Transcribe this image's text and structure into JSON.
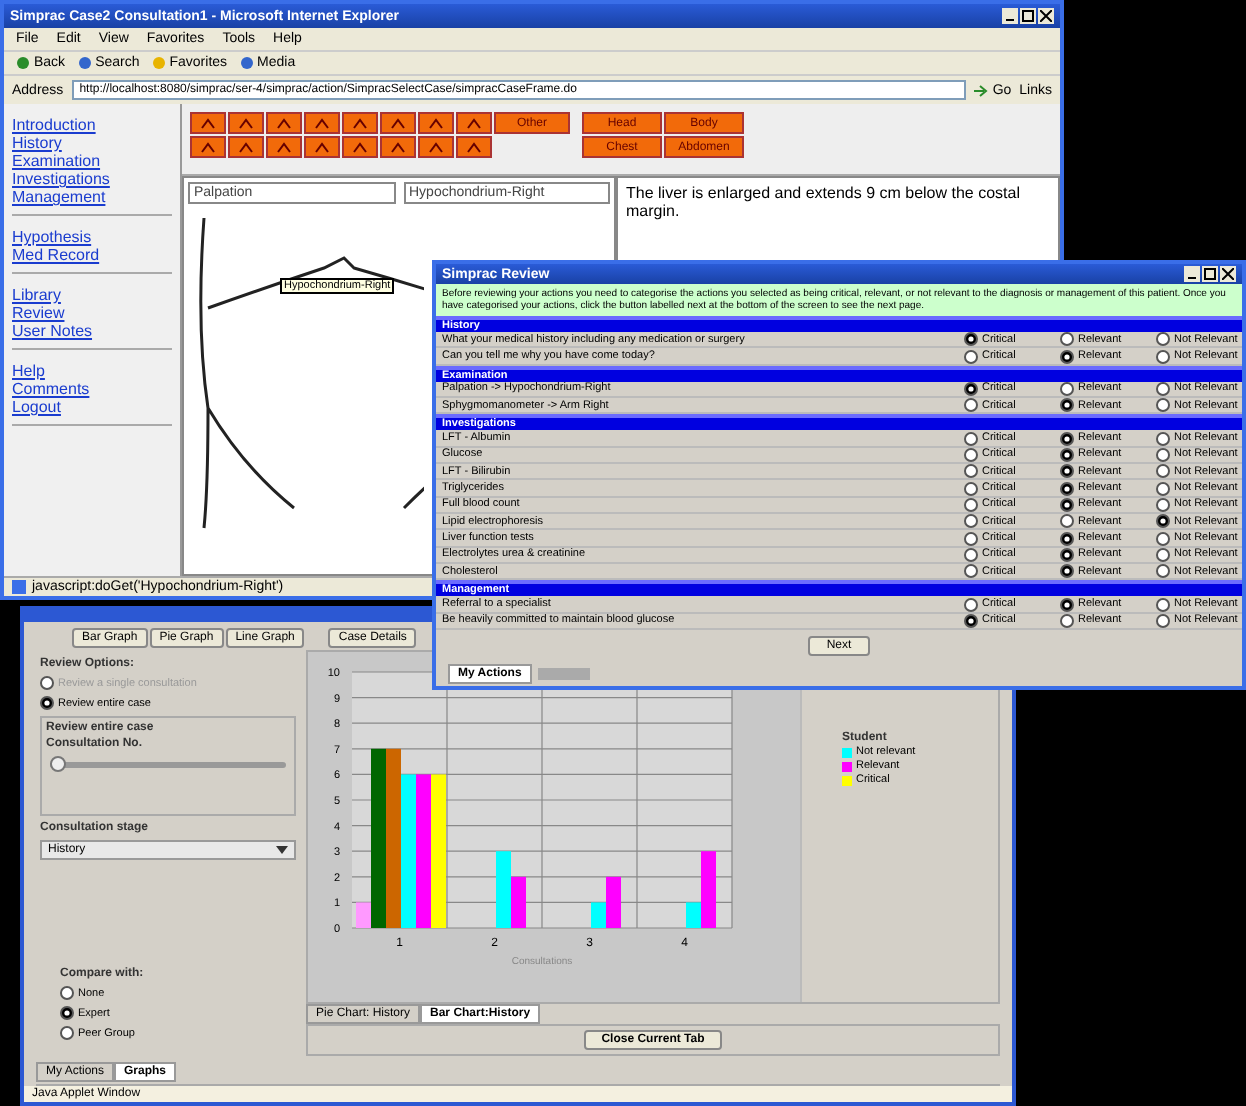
{
  "ie": {
    "title": "Simprac Case2 Consultation1 - Microsoft Internet Explorer",
    "menu": [
      "File",
      "Edit",
      "View",
      "Favorites",
      "Tools",
      "Help"
    ],
    "toolbar": [
      "Back",
      "Search",
      "Favorites",
      "Media"
    ],
    "address_label": "Address",
    "address": "http://localhost:8080/simprac/ser-4/simprac/action/SimpracSelectCase/simpracCaseFrame.do",
    "go": "Go",
    "links": "Links",
    "nav_groups": [
      [
        "Introduction",
        "History",
        "Examination",
        "Investigations",
        "Management"
      ],
      [
        "Hypothesis",
        "Med Record"
      ],
      [
        "Library",
        "Review",
        "User Notes"
      ],
      [
        "Help",
        "Comments",
        "Logout"
      ]
    ],
    "region_buttons": [
      [
        "Other"
      ],
      [
        "Head",
        "Body"
      ],
      [
        "Chest",
        "Abdomen"
      ]
    ],
    "exam_method": "Palpation",
    "exam_site": "Hypochondrium-Right",
    "tooltip": "Hypochondrium-Right",
    "finding": "The liver is enlarged and extends 9 cm below the costal margin.",
    "status": "javascript:doGet('Hypochondrium-Right')"
  },
  "review": {
    "title": "Simprac Review",
    "instructions": "Before reviewing your actions you need to categorise the actions you selected as being critical, relevant, or not relevant to the diagnosis or management of this patient. Once you have categorised your actions, click the button labelled next at the bottom of the screen to see the next page.",
    "sections": [
      {
        "heading": "History",
        "rows": [
          {
            "question": "What your medical history including any medication or surgery",
            "options": [
              {
                "label": "Critical",
                "selected": true
              },
              {
                "label": "Relevant",
                "selected": false
              },
              {
                "label": "Not Relevant",
                "selected": false
              }
            ]
          },
          {
            "question": "Can you tell me why you have come today?",
            "options": [
              {
                "label": "Critical",
                "selected": false
              },
              {
                "label": "Relevant",
                "selected": true
              },
              {
                "label": "Not Relevant",
                "selected": false
              }
            ]
          }
        ]
      },
      {
        "heading": "Examination",
        "rows": [
          {
            "question": "Palpation -> Hypochondrium-Right",
            "options": [
              {
                "label": "Critical",
                "selected": true
              },
              {
                "label": "Relevant",
                "selected": false
              },
              {
                "label": "Not Relevant",
                "selected": false
              }
            ]
          },
          {
            "question": "Sphygmomanometer -> Arm Right",
            "options": [
              {
                "label": "Critical",
                "selected": false
              },
              {
                "label": "Relevant",
                "selected": true
              },
              {
                "label": "Not Relevant",
                "selected": false
              }
            ]
          }
        ]
      },
      {
        "heading": "Investigations",
        "rows": [
          {
            "question": "LFT - Albumin",
            "options": [
              {
                "label": "Critical",
                "selected": false
              },
              {
                "label": "Relevant",
                "selected": true
              },
              {
                "label": "Not Relevant",
                "selected": false
              }
            ]
          },
          {
            "question": "Glucose",
            "options": [
              {
                "label": "Critical",
                "selected": false
              },
              {
                "label": "Relevant",
                "selected": true
              },
              {
                "label": "Not Relevant",
                "selected": false
              }
            ]
          },
          {
            "question": "LFT - Bilirubin",
            "options": [
              {
                "label": "Critical",
                "selected": false
              },
              {
                "label": "Relevant",
                "selected": true
              },
              {
                "label": "Not Relevant",
                "selected": false
              }
            ]
          },
          {
            "question": "Triglycerides",
            "options": [
              {
                "label": "Critical",
                "selected": false
              },
              {
                "label": "Relevant",
                "selected": true
              },
              {
                "label": "Not Relevant",
                "selected": false
              }
            ]
          },
          {
            "question": "Full blood count",
            "options": [
              {
                "label": "Critical",
                "selected": false
              },
              {
                "label": "Relevant",
                "selected": true
              },
              {
                "label": "Not Relevant",
                "selected": false
              }
            ]
          },
          {
            "question": "Lipid electrophoresis",
            "options": [
              {
                "label": "Critical",
                "selected": false
              },
              {
                "label": "Relevant",
                "selected": false
              },
              {
                "label": "Not Relevant",
                "selected": true
              }
            ]
          },
          {
            "question": "Liver function tests",
            "options": [
              {
                "label": "Critical",
                "selected": false
              },
              {
                "label": "Relevant",
                "selected": true
              },
              {
                "label": "Not Relevant",
                "selected": false
              }
            ]
          },
          {
            "question": "Electrolytes urea & creatinine",
            "options": [
              {
                "label": "Critical",
                "selected": false
              },
              {
                "label": "Relevant",
                "selected": true
              },
              {
                "label": "Not Relevant",
                "selected": false
              }
            ]
          },
          {
            "question": "Cholesterol",
            "options": [
              {
                "label": "Critical",
                "selected": false
              },
              {
                "label": "Relevant",
                "selected": true
              },
              {
                "label": "Not Relevant",
                "selected": false
              }
            ]
          }
        ]
      },
      {
        "heading": "Management",
        "rows": [
          {
            "question": "Referral to a specialist",
            "options": [
              {
                "label": "Critical",
                "selected": false
              },
              {
                "label": "Relevant",
                "selected": true
              },
              {
                "label": "Not Relevant",
                "selected": false
              }
            ]
          },
          {
            "question": "Be heavily committed to maintain blood glucose",
            "options": [
              {
                "label": "Critical",
                "selected": true
              },
              {
                "label": "Relevant",
                "selected": false
              },
              {
                "label": "Not Relevant",
                "selected": false
              }
            ]
          }
        ]
      }
    ],
    "next": "Next",
    "tab": "My Actions"
  },
  "applet": {
    "graph_buttons": [
      "Bar Graph",
      "Pie Graph",
      "Line Graph"
    ],
    "details_button": "Case Details",
    "review_label": "Review Options:",
    "review_options": [
      {
        "label": "Review a single consultation",
        "selected": false,
        "disabled": true
      },
      {
        "label": "Review entire case",
        "selected": true,
        "disabled": false
      }
    ],
    "group_label": "Review entire case",
    "slider_label": "Consultation No.",
    "slider": {
      "level": 0
    },
    "stage_label": "Consultation stage",
    "stage_value": "History",
    "compare_label": "Compare with:",
    "compare_options": [
      {
        "label": "None",
        "selected": false
      },
      {
        "label": "Expert",
        "selected": true
      },
      {
        "label": "Peer Group",
        "selected": false
      }
    ],
    "chart_data": {
      "type": "bar",
      "grid": true,
      "xlabel": "Consultations",
      "categories": [
        "1",
        "2",
        "3",
        "4"
      ],
      "yticks": [
        0,
        1,
        2,
        3,
        4,
        5,
        6,
        7,
        8,
        9,
        10
      ],
      "ylim": [
        0,
        10
      ],
      "series": [
        {
          "color": "#ff99ff",
          "values": [
            1,
            0,
            0,
            0
          ]
        },
        {
          "color": "#006600",
          "values": [
            7,
            0,
            0,
            0
          ]
        },
        {
          "color": "#cc6600",
          "values": [
            7,
            0,
            0,
            0
          ]
        },
        {
          "name": "Not relevant",
          "color": "#00ffff",
          "values": [
            6,
            3,
            1,
            1
          ]
        },
        {
          "name": "Relevant",
          "color": "#ff00ff",
          "values": [
            6,
            2,
            2,
            3
          ]
        },
        {
          "name": "Critical",
          "color": "#ffff00",
          "values": [
            6,
            0,
            0,
            0
          ]
        }
      ]
    },
    "legend_title": "Student",
    "chart_tabs": [
      {
        "label": "Pie Chart: History",
        "selected": false
      },
      {
        "label": "Bar Chart:History",
        "selected": true
      }
    ],
    "close_button": "Close Current Tab",
    "bottom_tabs": [
      {
        "label": "My Actions",
        "selected": false
      },
      {
        "label": "Graphs",
        "selected": true
      }
    ],
    "status": "Java Applet Window"
  }
}
